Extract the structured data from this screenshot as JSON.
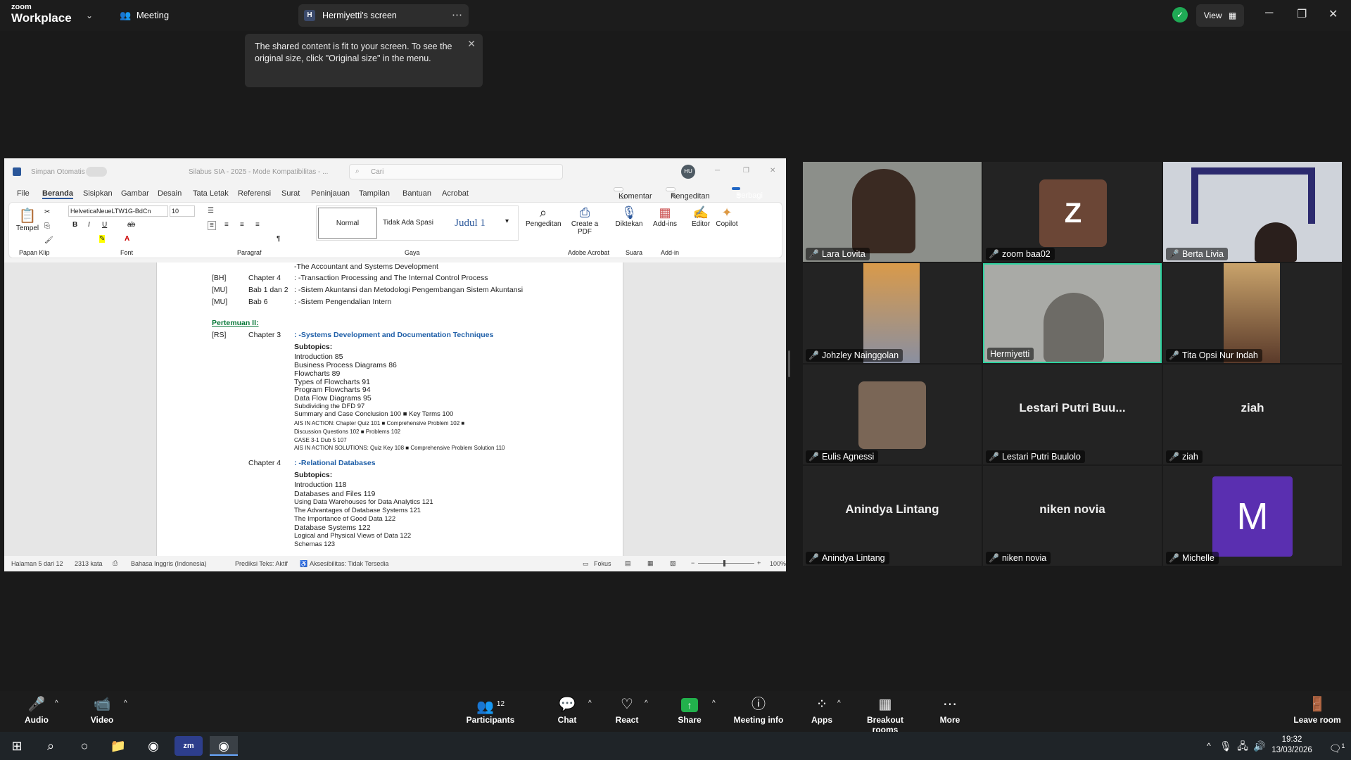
{
  "topbar": {
    "logo_small": "zoom",
    "logo_big": "Workplace",
    "meeting_label": "Meeting",
    "screen_badge": "H",
    "screen_tab_label": "Hermiyetti's screen",
    "view_label": "View"
  },
  "tooltip": {
    "text": "The shared content is fit to your screen. To see the original size, click \"Original size\" in the menu."
  },
  "word": {
    "autosave": "Simpan Otomatis",
    "doc_title": "Silabus SIA - 2025  -  Mode Kompatibilitas  -  ...",
    "search_placeholder": "Cari",
    "user_initials": "HU",
    "menu": [
      "File",
      "Beranda",
      "Sisipkan",
      "Gambar",
      "Desain",
      "Tata Letak",
      "Referensi",
      "Surat",
      "Peninjauan",
      "Tampilan",
      "Bantuan",
      "Acrobat"
    ],
    "komentar": "Komentar",
    "pengeditan": "Pengeditan",
    "berbagi": "Berbagi",
    "ribbon": {
      "tempel": "Tempel",
      "font_name": "HelveticaNeueLTW1G-BdCn",
      "font_size": "10",
      "styles": [
        "Normal",
        "Tidak Ada Spasi",
        "Judul 1"
      ],
      "pengeditan": "Pengeditan",
      "create_pdf": "Create a PDF",
      "diktekan": "Diktekan",
      "addins": "Add-ins",
      "editor": "Editor",
      "copilot": "Copilot",
      "groups": [
        "Papan Klip",
        "Font",
        "Paragraf",
        "Gaya",
        "Adobe Acrobat",
        "Suara",
        "Add-in"
      ]
    },
    "doc": {
      "line0": "-The Accountant and Systems Development",
      "rows": [
        {
          "tag": "[BH]",
          "ch": "Chapter 4",
          "text": ": -Transaction Processing and The Internal Control Process"
        },
        {
          "tag": "[MU]",
          "ch": "Bab 1 dan 2",
          "text": ": -Sistem Akuntansi dan Metodologi Pengembangan Sistem Akuntansi"
        },
        {
          "tag": "[MU]",
          "ch": "Bab 6",
          "text": ": -Sistem Pengendalian Intern"
        }
      ],
      "pertemuan": "Pertemuan II:",
      "ch3_tag": "[RS]",
      "ch3": "Chapter 3",
      "ch3_title": ": -Systems Development and Documentation Techniques",
      "subtopics": "Subtopics:",
      "ch3_items": [
        "Introduction 85",
        "Business Process Diagrams 86",
        "Flowcharts 89",
        "Types of Flowcharts 91",
        "Program Flowcharts 94",
        "Data Flow Diagrams 95",
        "Subdividing the DFD 97",
        "Summary and Case Conclusion 100 ■ Key Terms 100"
      ],
      "ch3_small": [
        "AIS IN ACTION: Chapter Quiz 101 ■ Comprehensive Problem 102 ■",
        "Discussion Questions 102 ■ Problems 102",
        "CASE 3-1 Dub 5 107",
        "AIS IN ACTION SOLUTIONS: Quiz Key 108 ■ Comprehensive Problem Solution 110"
      ],
      "ch4": "Chapter 4",
      "ch4_title": ": -Relational Databases",
      "ch4_items": [
        "Introduction 118",
        "Databases and Files 119",
        "Using Data Warehouses for Data Analytics 121",
        "The Advantages of Database Systems 121",
        "The Importance of Good Data 122",
        "Database Systems 122",
        "Logical and Physical Views of Data 122",
        "Schemas 123"
      ]
    },
    "status": {
      "page": "Halaman 5 dari 12",
      "words": "2313 kata",
      "lang": "Bahasa Inggris (Indonesia)",
      "prediksi": "Prediksi Teks: Aktif",
      "aksesibilitas": "Aksesibilitas: Tidak Tersedia",
      "fokus": "Fokus",
      "zoom": "100%"
    }
  },
  "participants": [
    {
      "name": "Lara Lovita",
      "type": "video",
      "bg": "#8c8f8a"
    },
    {
      "name": "zoom baa02",
      "type": "avatar",
      "letter": "Z",
      "color": "#6b4636"
    },
    {
      "name": "Berta Livia",
      "type": "video",
      "bg": "#cfd3da"
    },
    {
      "name": "Johzley Nainggolan",
      "type": "video",
      "bg": "#c98a3c"
    },
    {
      "name": "Hermiyetti",
      "type": "video",
      "bg": "#a9aaa6",
      "active": true
    },
    {
      "name": "Tita Opsi Nur Indah",
      "type": "video",
      "bg": "#c9a36b"
    },
    {
      "name": "Eulis Agnessi",
      "type": "video",
      "bg": "#7a6656"
    },
    {
      "name": "Lestari Putri Buulolo",
      "type": "text",
      "display": "Lestari Putri Buu..."
    },
    {
      "name": "ziah",
      "type": "text",
      "display": "ziah"
    },
    {
      "name": "Anindya Lintang",
      "type": "text",
      "display": "Anindya Lintang"
    },
    {
      "name": "niken novia",
      "type": "text",
      "display": "niken novia"
    },
    {
      "name": "Michelle",
      "type": "avatar",
      "letter": "M",
      "color": "#5a2fb0"
    }
  ],
  "toolbar": {
    "audio": "Audio",
    "video": "Video",
    "participants": "Participants",
    "participants_count": "12",
    "chat": "Chat",
    "react": "React",
    "share": "Share",
    "meeting_info": "Meeting info",
    "apps": "Apps",
    "breakout": "Breakout rooms",
    "more": "More",
    "leave": "Leave room"
  },
  "taskbar": {
    "time": "19:32",
    "date": "13/03/2026",
    "notif": "1"
  },
  "colors": {
    "share_green": "#22b14c",
    "active_border": "#2ed3a0",
    "mute_red": "#e14b4b",
    "berbagi_blue": "#2066c4"
  }
}
